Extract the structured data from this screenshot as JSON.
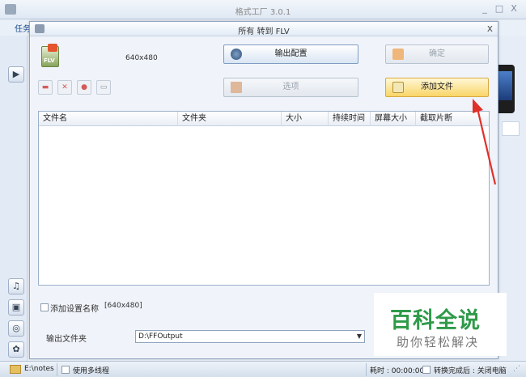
{
  "app": {
    "title": "格式工厂 3.0.1",
    "tab_label": "任务",
    "controls": {
      "min": "_",
      "max": "□",
      "close": "X"
    }
  },
  "sidebar_icons": [
    "video-icon",
    "audio-icon",
    "picture-icon",
    "rom-icon",
    "advanced-icon"
  ],
  "dialog": {
    "title": "所有 转到 FLV",
    "close": "x",
    "format_icon_label": "FLV",
    "resolution": "640x480",
    "buttons": {
      "output_config": "输出配置",
      "ok": "确定",
      "options": "选项",
      "add_file": "添加文件"
    },
    "table": {
      "columns": [
        "文件名",
        "文件夹",
        "大小",
        "持续时间",
        "屏幕大小",
        "截取片断"
      ],
      "rows": []
    },
    "add_setting_name_label": "添加设置名称",
    "add_setting_name_value": "[640x480]",
    "output_folder_label": "输出文件夹",
    "output_folder_value": "D:\\FFOutput"
  },
  "status": {
    "path": "E:\\notes",
    "multithread_label": "使用多线程",
    "elapsed": "耗时 : 00:00:00",
    "after_finish": "转换完成后 : 关闭电脑"
  },
  "watermark": {
    "line1": "百科全说",
    "line2": "助你轻松解决"
  },
  "colors": {
    "accent": "#1a4d8f",
    "add_button": "#f9d567",
    "arrow": "#e0302a",
    "watermark": "#2f9a4a"
  }
}
